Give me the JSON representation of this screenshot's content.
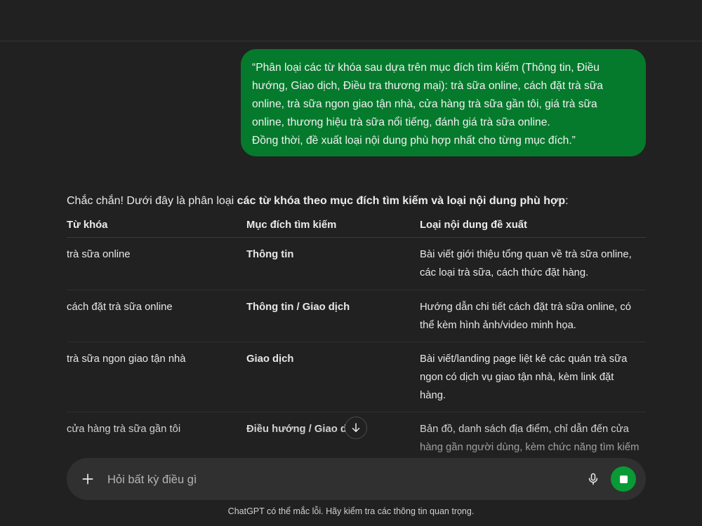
{
  "user_message": {
    "lines": [
      "“Phân loại các từ khóa sau dựa trên mục đích tìm kiếm (Thông tin, Điều",
      "hướng, Giao dịch, Điều tra thương mại): trà sữa online, cách đặt trà sữa",
      "online, trà sữa ngon giao tận nhà, cửa hàng trà sữa gần tôi, giá trà sữa",
      "online, thương hiệu trà sữa nổi tiếng, đánh giá trà sữa online.",
      "Đồng thời, đề xuất loại nội dung phù hợp nhất cho từng mục đích.”"
    ]
  },
  "assistant": {
    "intro_plain": "Chắc chắn! Dưới đây là phân loại ",
    "intro_bold": "các từ khóa theo mục đích tìm kiếm và loại nội dung phù hợp",
    "intro_end": ":"
  },
  "table": {
    "headers": [
      "Từ khóa",
      "Mục đích tìm kiếm",
      "Loại nội dung đề xuất"
    ],
    "rows": [
      {
        "keyword": "trà sữa online",
        "intent": "Thông tin",
        "content_lines": [
          "Bài viết giới thiệu tổng quan về trà sữa online,",
          "các loại trà sữa, cách thức đặt hàng."
        ]
      },
      {
        "keyword": "cách đặt trà sữa online",
        "intent": "Thông tin / Giao dịch",
        "content_lines": [
          "Hướng dẫn chi tiết cách đặt trà sữa online, có",
          "thể kèm hình ảnh/video minh họa."
        ]
      },
      {
        "keyword": "trà sữa ngon giao tận nhà",
        "intent": "Giao dịch",
        "content_lines": [
          "Bài viết/landing page liệt kê các quán trà sữa",
          "ngon có dịch vụ giao tận nhà, kèm link đặt",
          "hàng."
        ]
      },
      {
        "keyword": "cửa hàng trà sữa gần tôi",
        "intent": "Điều hướng / Giao d",
        "content_lines": [
          "Bản đồ, danh sách địa điểm, chỉ dẫn đến cửa",
          "hàng gần người dùng, kèm chức năng tìm kiếm"
        ]
      }
    ]
  },
  "composer": {
    "placeholder": "Hỏi bất kỳ điều gì"
  },
  "icons": {
    "plus": "plus-icon",
    "mic": "microphone-icon",
    "stop": "stop-icon",
    "scroll": "arrow-down-icon"
  },
  "colors": {
    "background": "#212121",
    "user_bubble": "#057a2c",
    "stop_button": "#0a9a35",
    "composer": "#303030"
  },
  "disclaimer": "ChatGPT có thể mắc lỗi. Hãy kiểm tra các thông tin quan trọng."
}
